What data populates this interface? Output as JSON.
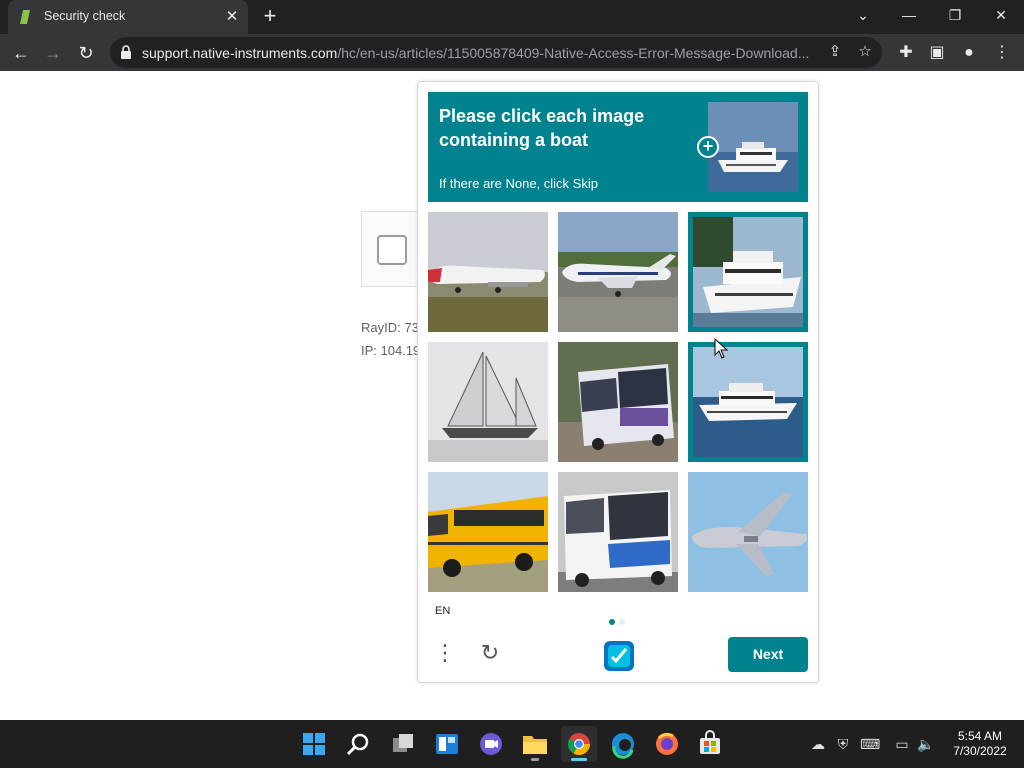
{
  "browser": {
    "tab_title": "Security check",
    "url_host": "support.native-instruments.com",
    "url_path": "/hc/en-us/articles/115005878409-Native-Access-Error-Message-Download..."
  },
  "page": {
    "ray_id": "RayID: 73",
    "ip": "IP: 104.19"
  },
  "captcha": {
    "prompt_line1": "Please click each image",
    "prompt_line2": "containing a boat",
    "prompt_sub": "If there are None, click Skip",
    "language": "EN",
    "next_label": "Next",
    "accent": "#00838f",
    "tiles": [
      {
        "subject": "airplane",
        "selected": false
      },
      {
        "subject": "airplane",
        "selected": false
      },
      {
        "subject": "boat",
        "selected": true
      },
      {
        "subject": "sailboat",
        "selected": false
      },
      {
        "subject": "bus",
        "selected": false
      },
      {
        "subject": "boat",
        "selected": true
      },
      {
        "subject": "school-bus",
        "selected": false
      },
      {
        "subject": "bus",
        "selected": false
      },
      {
        "subject": "airplane",
        "selected": false
      }
    ],
    "pagination": {
      "pages": 2,
      "current": 1
    }
  },
  "taskbar": {
    "apps": [
      "start",
      "search",
      "task-view",
      "widgets",
      "chat",
      "file-explorer",
      "chrome",
      "edge",
      "firefox",
      "store"
    ],
    "active_app": "chrome",
    "time": "5:54 AM",
    "date": "7/30/2022"
  }
}
